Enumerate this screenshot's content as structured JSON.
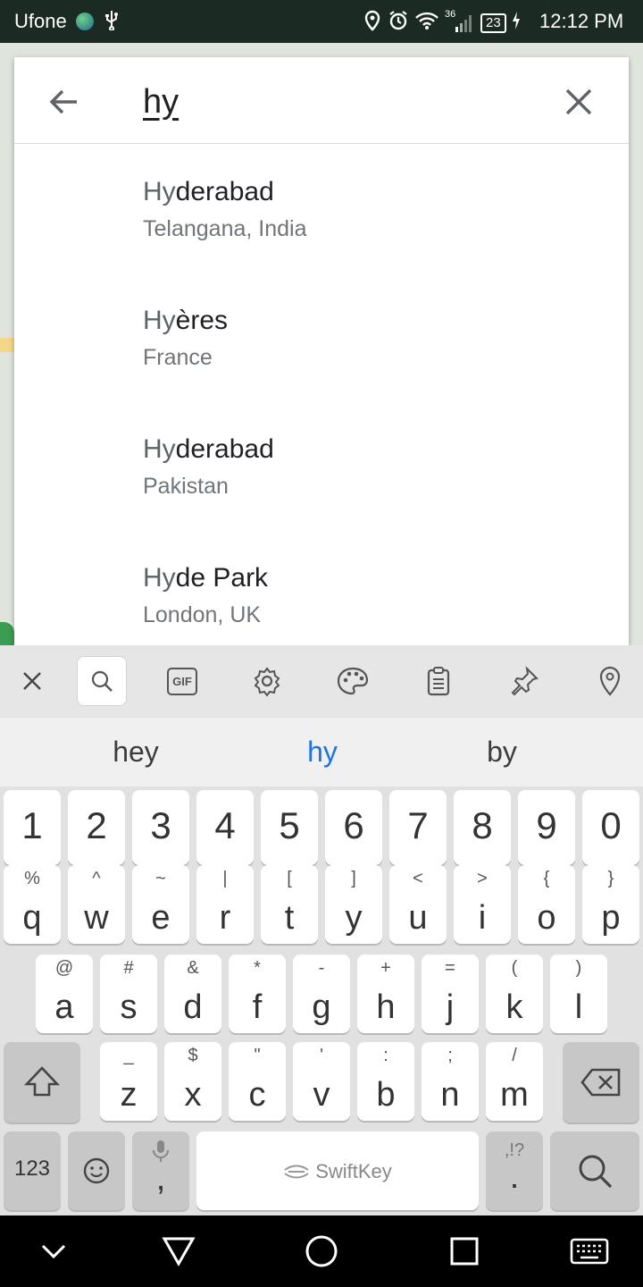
{
  "status_bar": {
    "carrier": "Ufone",
    "network": "36",
    "battery": "23",
    "time": "12:12 PM"
  },
  "search": {
    "query": "hy"
  },
  "results": [
    {
      "match": "Hy",
      "rest": "derabad",
      "subtitle": "Telangana, India"
    },
    {
      "match": "Hy",
      "rest": "ères",
      "subtitle": "France"
    },
    {
      "match": "Hy",
      "rest": "derabad",
      "subtitle": "Pakistan"
    },
    {
      "match": "Hy",
      "rest": "de Park",
      "subtitle": "London, UK"
    }
  ],
  "keyboard": {
    "toolbar_icons": [
      "close-icon",
      "search-icon",
      "gif-icon",
      "gear-icon",
      "palette-icon",
      "clipboard-icon",
      "pin-icon",
      "location-icon"
    ],
    "gif_label": "GIF",
    "suggestions": [
      "hey",
      "hy",
      "by"
    ],
    "suggestion_highlight_color": "#1a73e8",
    "numbers": [
      "1",
      "2",
      "3",
      "4",
      "5",
      "6",
      "7",
      "8",
      "9",
      "0"
    ],
    "row1": [
      {
        "k": "q",
        "s": "%"
      },
      {
        "k": "w",
        "s": "^"
      },
      {
        "k": "e",
        "s": "~"
      },
      {
        "k": "r",
        "s": "|"
      },
      {
        "k": "t",
        "s": "["
      },
      {
        "k": "y",
        "s": "]"
      },
      {
        "k": "u",
        "s": "<"
      },
      {
        "k": "i",
        "s": ">"
      },
      {
        "k": "o",
        "s": "{"
      },
      {
        "k": "p",
        "s": "}"
      }
    ],
    "row2": [
      {
        "k": "a",
        "s": "@"
      },
      {
        "k": "s",
        "s": "#"
      },
      {
        "k": "d",
        "s": "&"
      },
      {
        "k": "f",
        "s": "*"
      },
      {
        "k": "g",
        "s": "-"
      },
      {
        "k": "h",
        "s": "+"
      },
      {
        "k": "j",
        "s": "="
      },
      {
        "k": "k",
        "s": "("
      },
      {
        "k": "l",
        "s": ")"
      }
    ],
    "row3": [
      {
        "k": "z",
        "s": "_"
      },
      {
        "k": "x",
        "s": "$"
      },
      {
        "k": "c",
        "s": "\""
      },
      {
        "k": "v",
        "s": "'"
      },
      {
        "k": "b",
        "s": ":"
      },
      {
        "k": "n",
        "s": ";"
      },
      {
        "k": "m",
        "s": "/"
      }
    ],
    "numbers_label": "123",
    "comma": ",",
    "space_brand": "SwiftKey",
    "period": ".",
    "period_alt": ",!?"
  }
}
